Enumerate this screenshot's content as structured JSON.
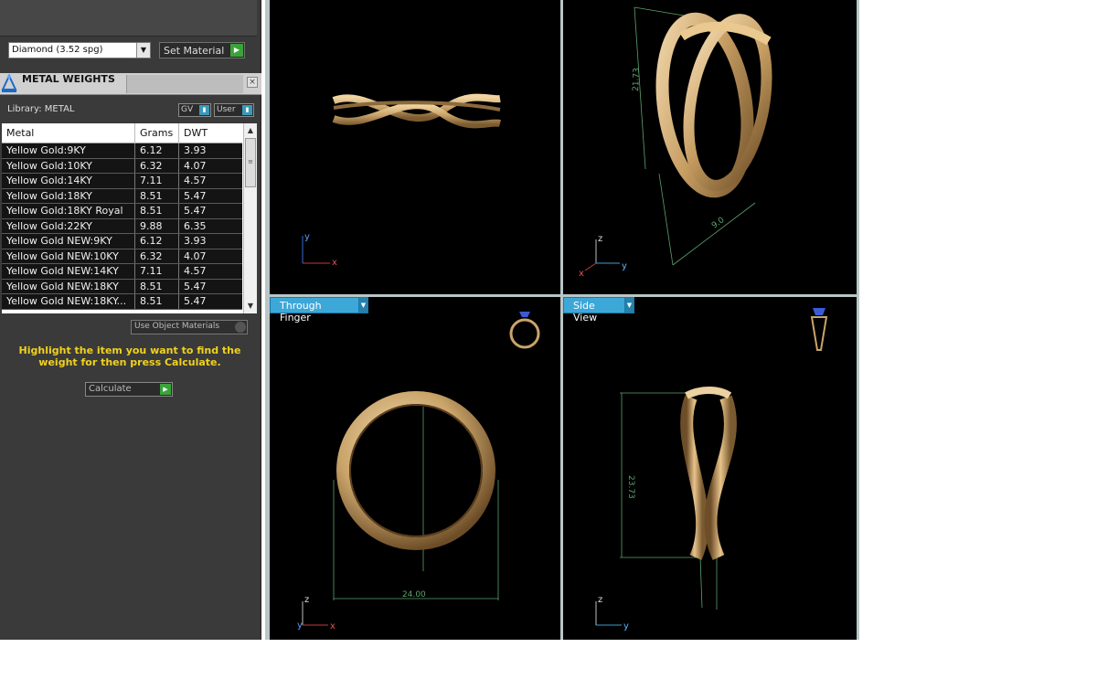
{
  "left_panel": {
    "material_select": "Diamond     (3.52 spg)",
    "set_material_label": "Set Material",
    "metal_weights_title": "METAL WEIGHTS",
    "library_label": "Library: METAL",
    "gv_label": "GV",
    "user_label": "User",
    "table": {
      "columns": [
        "Metal",
        "Grams",
        "DWT"
      ],
      "rows": [
        {
          "metal": "Yellow Gold:9KY",
          "grams": "6.12",
          "dwt": "3.93"
        },
        {
          "metal": "Yellow Gold:10KY",
          "grams": "6.32",
          "dwt": "4.07"
        },
        {
          "metal": "Yellow Gold:14KY",
          "grams": "7.11",
          "dwt": "4.57"
        },
        {
          "metal": "Yellow Gold:18KY",
          "grams": "8.51",
          "dwt": "5.47"
        },
        {
          "metal": "Yellow Gold:18KY Royal",
          "grams": "8.51",
          "dwt": "5.47"
        },
        {
          "metal": "Yellow Gold:22KY",
          "grams": "9.88",
          "dwt": "6.35"
        },
        {
          "metal": "Yellow Gold NEW:9KY",
          "grams": "6.12",
          "dwt": "3.93"
        },
        {
          "metal": "Yellow Gold NEW:10KY",
          "grams": "6.32",
          "dwt": "4.07"
        },
        {
          "metal": "Yellow Gold NEW:14KY",
          "grams": "7.11",
          "dwt": "4.57"
        },
        {
          "metal": "Yellow Gold NEW:18KY",
          "grams": "8.51",
          "dwt": "5.47"
        },
        {
          "metal": "Yellow Gold NEW:18KY...",
          "grams": "8.51",
          "dwt": "5.47"
        }
      ]
    },
    "use_object_materials_label": "Use Object Materials",
    "hint_text": "Highlight the item you want to find the weight for then press Calculate.",
    "calculate_label": "Calculate"
  },
  "viewports": {
    "bottom_left_tab": "Through Finger",
    "bottom_right_tab": "Side View",
    "dim_top_right": "21.73",
    "dim_top_right_2": "9.0",
    "dim_bottom_left": "24.00",
    "dim_bottom_right": "23.73",
    "axis_x": "x",
    "axis_y": "y",
    "axis_z": "z"
  },
  "colors": {
    "gold": "#c9a46a",
    "hint_yellow": "#f1d11e",
    "tab_blue": "#3da7d8",
    "panel_bg": "#3a3a3a"
  }
}
